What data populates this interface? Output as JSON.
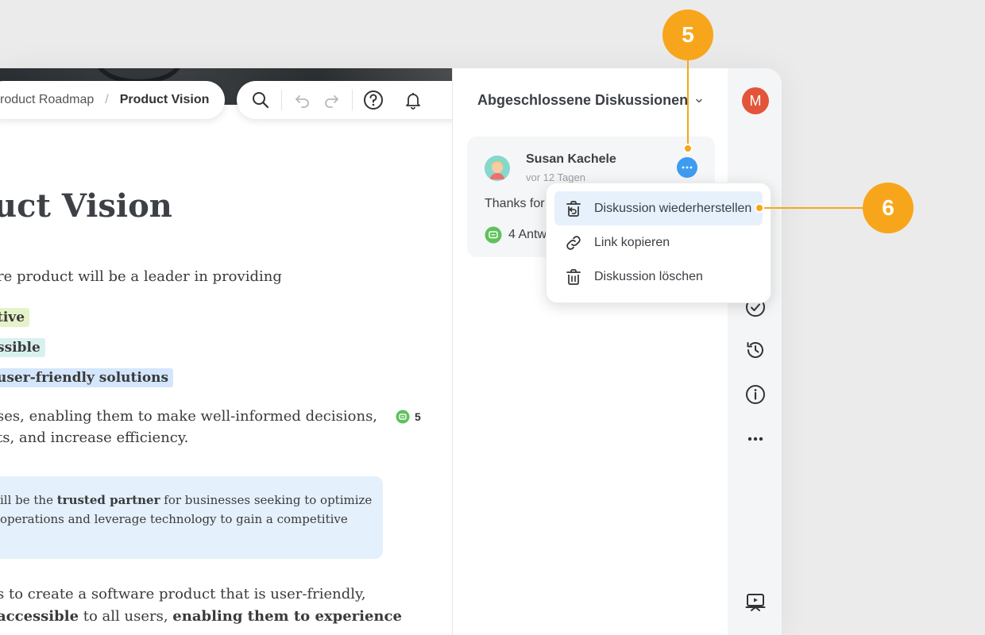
{
  "breadcrumb": {
    "parent": "roduct Roadmap",
    "separator": "/",
    "current": "Product Vision"
  },
  "toolbar": {
    "icons": [
      "search-icon",
      "undo-icon",
      "redo-icon",
      "help-icon",
      "bell-icon"
    ]
  },
  "document": {
    "title": "uct Vision",
    "intro": "re product will be a leader in providing",
    "highlights": [
      "tive",
      "ssible",
      "user-friendly solutions"
    ],
    "paragraph_line1": "ses, enabling them to make well-informed decisions,",
    "paragraph_line2": "ts, and increase efficiency.",
    "comment_count": "5",
    "callout": {
      "line1_pre": "ill be the ",
      "line1_bold": "trusted partner",
      "line1_post": " for businesses seeking to optimize",
      "line2": "operations and leverage technology to gain a competitive"
    },
    "bottom_line1": "s to create a software product that is user-friendly,",
    "bottom_line2_bold1": " accessible",
    "bottom_line2_mid": " to all users, ",
    "bottom_line2_bold2": "enabling them to experience"
  },
  "panel": {
    "header": "Abgeschlossene Diskussionen",
    "discussion": {
      "author": "Susan Kachele",
      "time": "vor 12 Tagen",
      "text": "Thanks for",
      "replies": "4 Antw"
    }
  },
  "context_menu": {
    "items": [
      {
        "label": "Diskussion wiederherstellen",
        "icon": "restore-icon"
      },
      {
        "label": "Link kopieren",
        "icon": "link-icon"
      },
      {
        "label": "Diskussion löschen",
        "icon": "trash-icon"
      }
    ]
  },
  "rail": {
    "user_initial": "M",
    "icons": [
      "check-circle-icon",
      "history-icon",
      "info-icon",
      "more-icon",
      "presentation-icon"
    ]
  },
  "markers": {
    "first": "5",
    "second": "6"
  },
  "colors": {
    "accent": "#f7a61b",
    "blue": "#3d9cf0",
    "avatar": "#e2553a"
  }
}
